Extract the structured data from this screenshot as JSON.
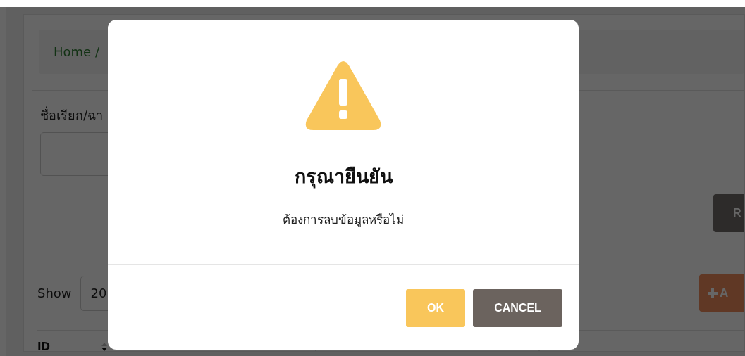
{
  "background": {
    "breadcrumb": "Home /",
    "filter_label": "ชื่อเรียก/ฉา",
    "reset_button": "R",
    "show_label": "Show",
    "page_size": "20",
    "add_button": "A",
    "columns": [
      {
        "label": "ID"
      }
    ]
  },
  "dialog": {
    "title": "กรุณายืนยัน",
    "message": "ต้องการลบข้อมูลหรือไม่",
    "buttons": [
      {
        "label": "OK",
        "kind": "confirm"
      },
      {
        "label": "CANCEL",
        "kind": "cancel"
      }
    ]
  }
}
